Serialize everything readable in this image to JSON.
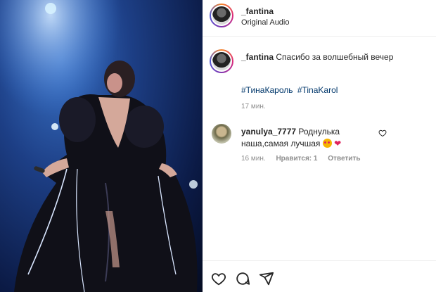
{
  "post": {
    "author": "_fantina",
    "audio": "Original Audio",
    "caption": "Спасибо за волшебный вечер",
    "hashtags": [
      "#ТинаКароль",
      "#TinaKarol"
    ],
    "time": "17 мин."
  },
  "comment": {
    "author": "yanulya_7777",
    "text": "Роднулька наша,самая лучшая",
    "emoji": "❤",
    "time": "16 мин.",
    "likes_label": "Нравится: 1",
    "reply_label": "Ответить"
  },
  "icons": [
    "heart-icon",
    "comment-icon",
    "share-icon",
    "comment-like-icon"
  ],
  "colors": {
    "link": "#00376b",
    "muted": "#8e8e8e",
    "stage_blue": "#1d3f86"
  }
}
